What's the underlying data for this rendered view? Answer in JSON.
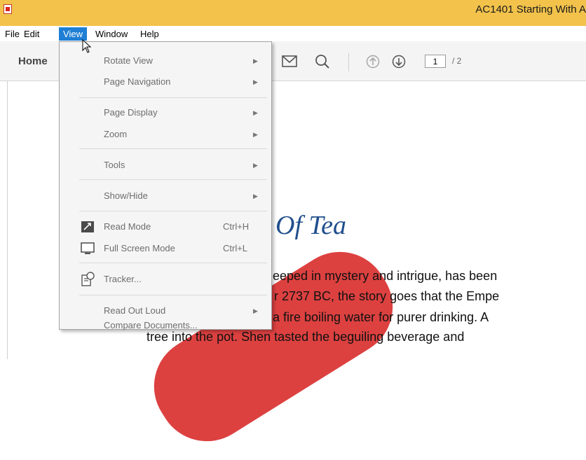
{
  "window": {
    "title": "AC1401 Starting With A"
  },
  "menubar": {
    "items": [
      "File",
      "Edit",
      "View",
      "Window",
      "Help"
    ]
  },
  "toolbar": {
    "home": "Home",
    "page_current": "1",
    "page_total": "/ 2"
  },
  "view_menu": {
    "rotate_view": "Rotate View",
    "page_navigation": "Page Navigation",
    "page_display": "Page Display",
    "zoom": "Zoom",
    "tools": "Tools",
    "show_hide": "Show/Hide",
    "read_mode": "Read Mode",
    "read_mode_shortcut": "Ctrl+H",
    "full_screen_mode": "Full Screen Mode",
    "full_screen_shortcut": "Ctrl+L",
    "tracker": "Tracker...",
    "read_out_loud": "Read Out Loud",
    "compare_documents": "Compare Documents..."
  },
  "document": {
    "heading": "Of Tea",
    "lines": [
      "eeped in mystery and intrigue, has been",
      "r 2737 BC, the story goes that the Empe",
      "a fire boiling water for purer drinking. A",
      "tree into the pot. Shen tasted the beguiling beverage and"
    ]
  },
  "colors": {
    "titlebar": "#f2c24b",
    "menu_active": "#1e7fd4",
    "heading": "#1f4e8c",
    "watermark": "#d6201f"
  }
}
